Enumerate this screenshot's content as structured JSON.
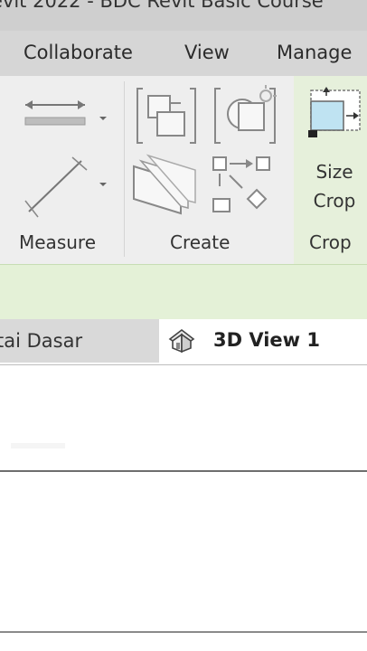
{
  "titlebar": {
    "text": "evit 2022 - BDC Revit Basic Course"
  },
  "ribbon_tabs": [
    "Collaborate",
    "View",
    "Manage"
  ],
  "panels": {
    "measure": {
      "label": "Measure"
    },
    "create": {
      "label": "Create"
    },
    "crop": {
      "label": "Crop",
      "size_crop_line1": "Size",
      "size_crop_line2": "Crop"
    }
  },
  "view_tabs": {
    "inactive": "tai Dasar",
    "active": "3D View 1"
  }
}
